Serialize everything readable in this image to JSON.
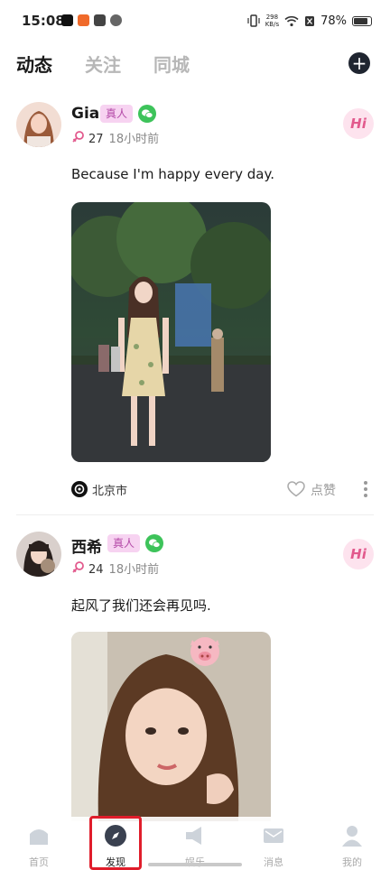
{
  "status": {
    "time": "15:08",
    "net_speed_value": "298",
    "net_speed_unit": "KB/s",
    "battery": "78%"
  },
  "tabs": [
    "动态",
    "关注",
    "同城"
  ],
  "posts": [
    {
      "username": "Gia",
      "badge": "真人",
      "age": "27",
      "time": "18小时前",
      "hi": "Hi",
      "text": "Because I'm happy every day.",
      "location": "北京市",
      "like": "点赞"
    },
    {
      "username": "西希",
      "badge": "真人",
      "age": "24",
      "time": "18小时前",
      "hi": "Hi",
      "text": "起风了我们还会再见吗."
    }
  ],
  "nav": [
    {
      "label": "首页"
    },
    {
      "label": "发现"
    },
    {
      "label": "娱乐"
    },
    {
      "label": "消息"
    },
    {
      "label": "我的"
    }
  ],
  "colors": {
    "accent_pink": "#e25a8d",
    "badge_bg": "#f7d3f1",
    "wechat_green": "#3dc35a",
    "highlight_red": "#e01d2b"
  }
}
